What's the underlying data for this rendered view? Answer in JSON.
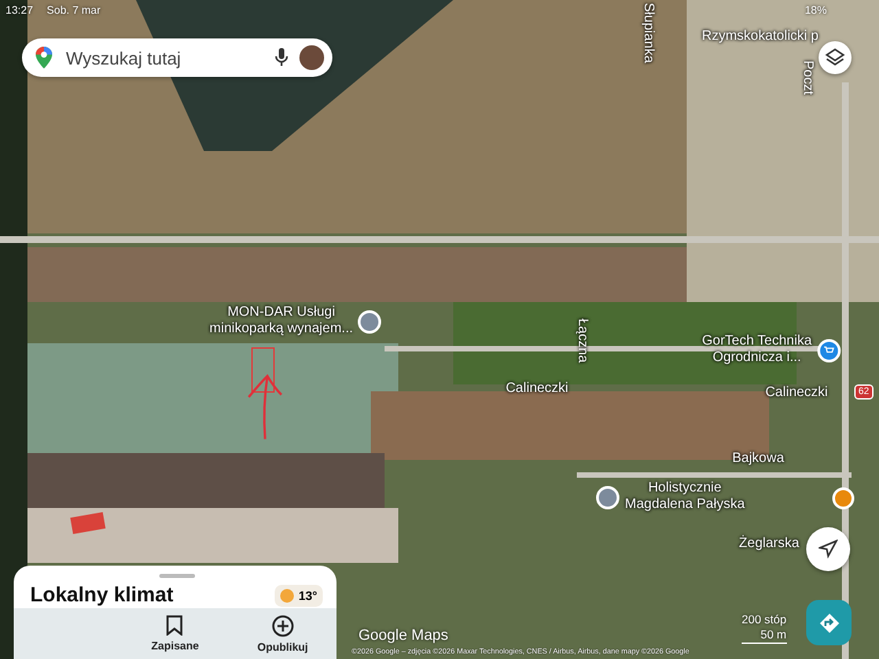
{
  "status_bar": {
    "time": "13:27",
    "date": "Sob. 7 mar",
    "battery": "18%"
  },
  "search": {
    "placeholder": "Wyszukaj tutaj"
  },
  "map": {
    "places": [
      {
        "name": "MON-DAR Usługi\nminikoparką wynajem...",
        "kind": "pin"
      },
      {
        "name": "GorTech Technika\nOgrodnicza i...",
        "kind": "shop"
      },
      {
        "name": "Holistycznie\nMagdalena Pałyska",
        "kind": "pin"
      },
      {
        "name": "Rzymskokatolicki p",
        "kind": "none"
      }
    ],
    "streets": [
      "Słupianka",
      "Poczt",
      "Łączna",
      "Calineczki",
      "Calineczki",
      "Bajkowa",
      "Żeglarska"
    ],
    "route_shield": "62",
    "logo": "Google Maps",
    "scale": [
      "200 stóp",
      "50 m"
    ],
    "attribution": "©2026 Google – zdjęcia ©2026 Maxar Technologies, CNES / Airbus, Airbus, dane mapy ©2026 Google"
  },
  "sheet": {
    "title": "Lokalny klimat",
    "temperature": "13°"
  },
  "nav": [
    {
      "label": "Zapisane"
    },
    {
      "label": "Opublikuj"
    }
  ]
}
